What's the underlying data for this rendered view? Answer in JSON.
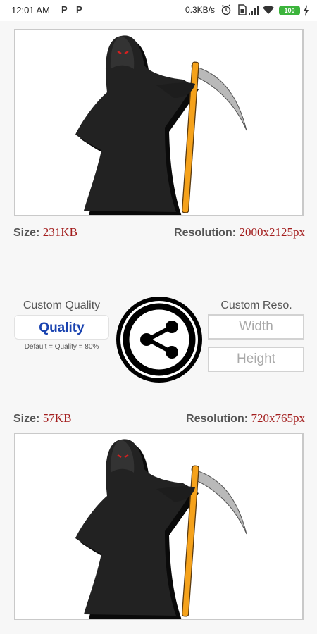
{
  "status_bar": {
    "time": "12:01 AM",
    "notif_1": "P",
    "notif_2": "P",
    "network_speed": "0.3KB/s",
    "battery_level": "100"
  },
  "original_image": {
    "size_label": "Size:",
    "size_value": "231KB",
    "resolution_label": "Resolution:",
    "resolution_value": "2000x2125px"
  },
  "controls": {
    "custom_quality_title": "Custom Quality",
    "quality_button": "Quality",
    "default_note": "Default = Quality = 80%",
    "custom_reso_title": "Custom Reso.",
    "width_placeholder": "Width",
    "height_placeholder": "Height",
    "share_icon": "share-icon"
  },
  "compressed_image": {
    "size_label": "Size:",
    "size_value": "57KB",
    "resolution_label": "Resolution:",
    "resolution_value": "720x765px"
  },
  "colors": {
    "value_red": "#a31d1d",
    "quality_blue": "#1a43b0",
    "scythe_orange": "#f5a21b"
  }
}
